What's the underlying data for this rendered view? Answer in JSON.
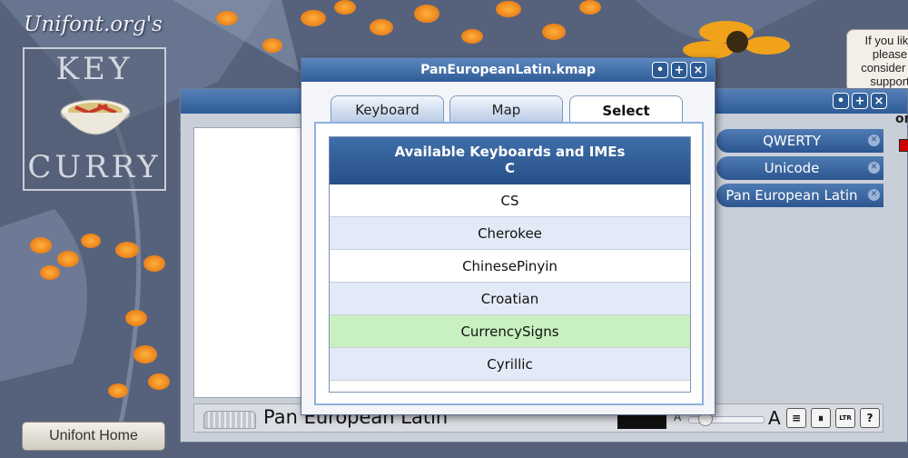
{
  "background": {
    "logo_caption": "Unifont.org's",
    "logo_word_top": "KEY",
    "logo_word_bottom": "CURRY",
    "home_button_label": "Unifont Home",
    "side_note_text": "If you like please consider to support services"
  },
  "keyboard_window": {
    "active_keyboards": [
      {
        "label": "QWERTY"
      },
      {
        "label": "Unicode"
      },
      {
        "label": "Pan European Latin"
      }
    ],
    "status": {
      "keyboard_name": "Pan European Latin",
      "font_small_label": "A",
      "font_large_label": "A",
      "font_size_level_percent": 15,
      "buttons": {
        "align": "≡",
        "pause": "⏸",
        "direction": "LTR",
        "help": "?"
      }
    },
    "right_label": "on"
  },
  "kmap_dialog": {
    "title": "PanEuropeanLatin.kmap",
    "tabs": [
      {
        "label": "Keyboard"
      },
      {
        "label": "Map"
      },
      {
        "label": "Select"
      }
    ],
    "active_tab": "Select",
    "list": {
      "header_title": "Available Keyboards and IMEs",
      "header_letter": "C",
      "items": [
        "CS",
        "Cherokee",
        "ChinesePinyin",
        "Croatian",
        "CurrencySigns",
        "Cyrillic"
      ],
      "selected_item": "CurrencySigns"
    }
  },
  "window_controls": {
    "minimize": "•",
    "maximize": "+",
    "close": "×"
  },
  "colors": {
    "titlebar_blue": "#2f5d98",
    "selected_row_green": "#c8f0c0",
    "alt_row_blue": "#e3eaf7"
  }
}
